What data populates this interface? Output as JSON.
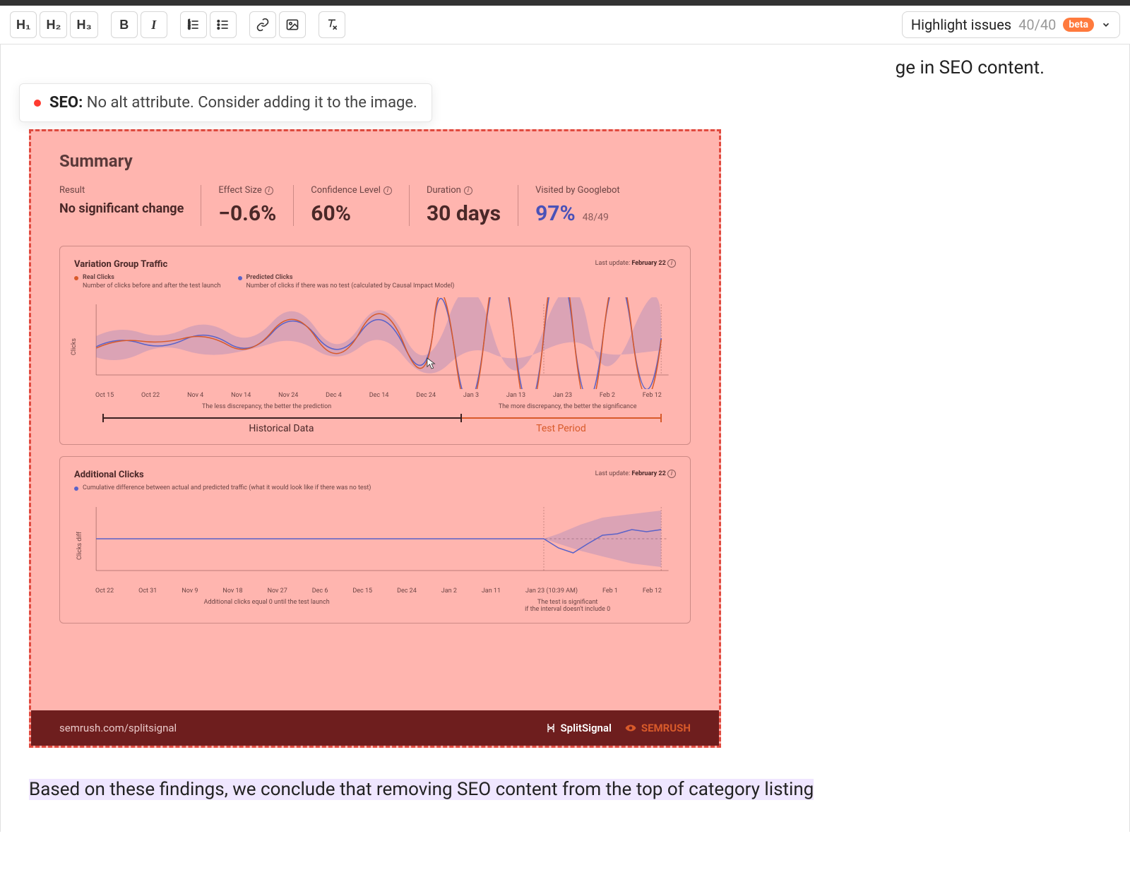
{
  "toolbar": {
    "h1": "H₁",
    "h2": "H₂",
    "h3": "H₃",
    "bold": "B",
    "italic": "I"
  },
  "highlight": {
    "label": "Highlight issues",
    "count": "40/40",
    "beta": "beta"
  },
  "trailing_text": "ge in SEO content.",
  "issue": {
    "category": "SEO:",
    "message": "No alt attribute. Consider adding it to the image."
  },
  "summary": {
    "title": "Summary",
    "result_label": "Result",
    "result_value": "No significant change",
    "effect_label": "Effect Size",
    "effect_value": "−0.6%",
    "conf_label": "Confidence Level",
    "conf_value": "60%",
    "dur_label": "Duration",
    "dur_value": "30 days",
    "visited_label": "Visited by Googlebot",
    "visited_value": "97%",
    "visited_sub": "48/49"
  },
  "chart1": {
    "title": "Variation Group Traffic",
    "legend1_name": "Real Clicks",
    "legend1_desc": "Number of clicks before and after the test launch",
    "legend2_name": "Predicted Clicks",
    "legend2_desc": "Number of clicks if there was no test (calculated by Causal Impact Model)",
    "last_update_label": "Last update:",
    "last_update_value": "February 22",
    "ylabel": "Clicks",
    "note_left": "The less discrepancy, the better the prediction",
    "note_right": "The more discrepancy, the better the significance",
    "period_hist": "Historical Data",
    "period_test": "Test Period"
  },
  "chart2": {
    "title": "Additional Clicks",
    "legend_desc": "Cumulative difference between actual and predicted traffic (what it would look like if there was no test)",
    "last_update_label": "Last update:",
    "last_update_value": "February 22",
    "ylabel": "Clicks diff",
    "note": "Additional clicks equal 0 until the test launch",
    "note_right1": "The test is significant",
    "note_right2": "if the interval doesn't include 0"
  },
  "footer": {
    "url": "semrush.com/splitsignal",
    "brand1": "SplitSignal",
    "brand2": "SEMRUSH"
  },
  "body_text": "Based on these findings, we conclude that removing SEO content from the top of category listing",
  "chart_data": [
    {
      "type": "line",
      "title": "Variation Group Traffic",
      "xlabel": "",
      "ylabel": "Clicks",
      "x": [
        "Oct 15",
        "Oct 22",
        "Nov 4",
        "Nov 14",
        "Nov 24",
        "Dec 4",
        "Dec 14",
        "Dec 24",
        "Jan 3",
        "Jan 13",
        "Jan 23",
        "Feb 2",
        "Feb 12"
      ],
      "series": [
        {
          "name": "Real Clicks",
          "color": "#d85a2a"
        },
        {
          "name": "Predicted Clicks",
          "color": "#5a62c8"
        }
      ],
      "annotations": [
        "Historical Data",
        "Test Period"
      ],
      "last_update": "February 22"
    },
    {
      "type": "line",
      "title": "Additional Clicks",
      "xlabel": "",
      "ylabel": "Clicks diff",
      "x": [
        "Oct 22",
        "Oct 31",
        "Nov 9",
        "Nov 18",
        "Nov 27",
        "Dec 6",
        "Dec 15",
        "Dec 24",
        "Jan 2",
        "Jan 11",
        "Jan 23 (10:39 AM)",
        "Feb 1",
        "Feb 12"
      ],
      "series": [
        {
          "name": "Cumulative difference",
          "color": "#5a62c8"
        }
      ],
      "baseline": 0,
      "last_update": "February 22"
    }
  ]
}
